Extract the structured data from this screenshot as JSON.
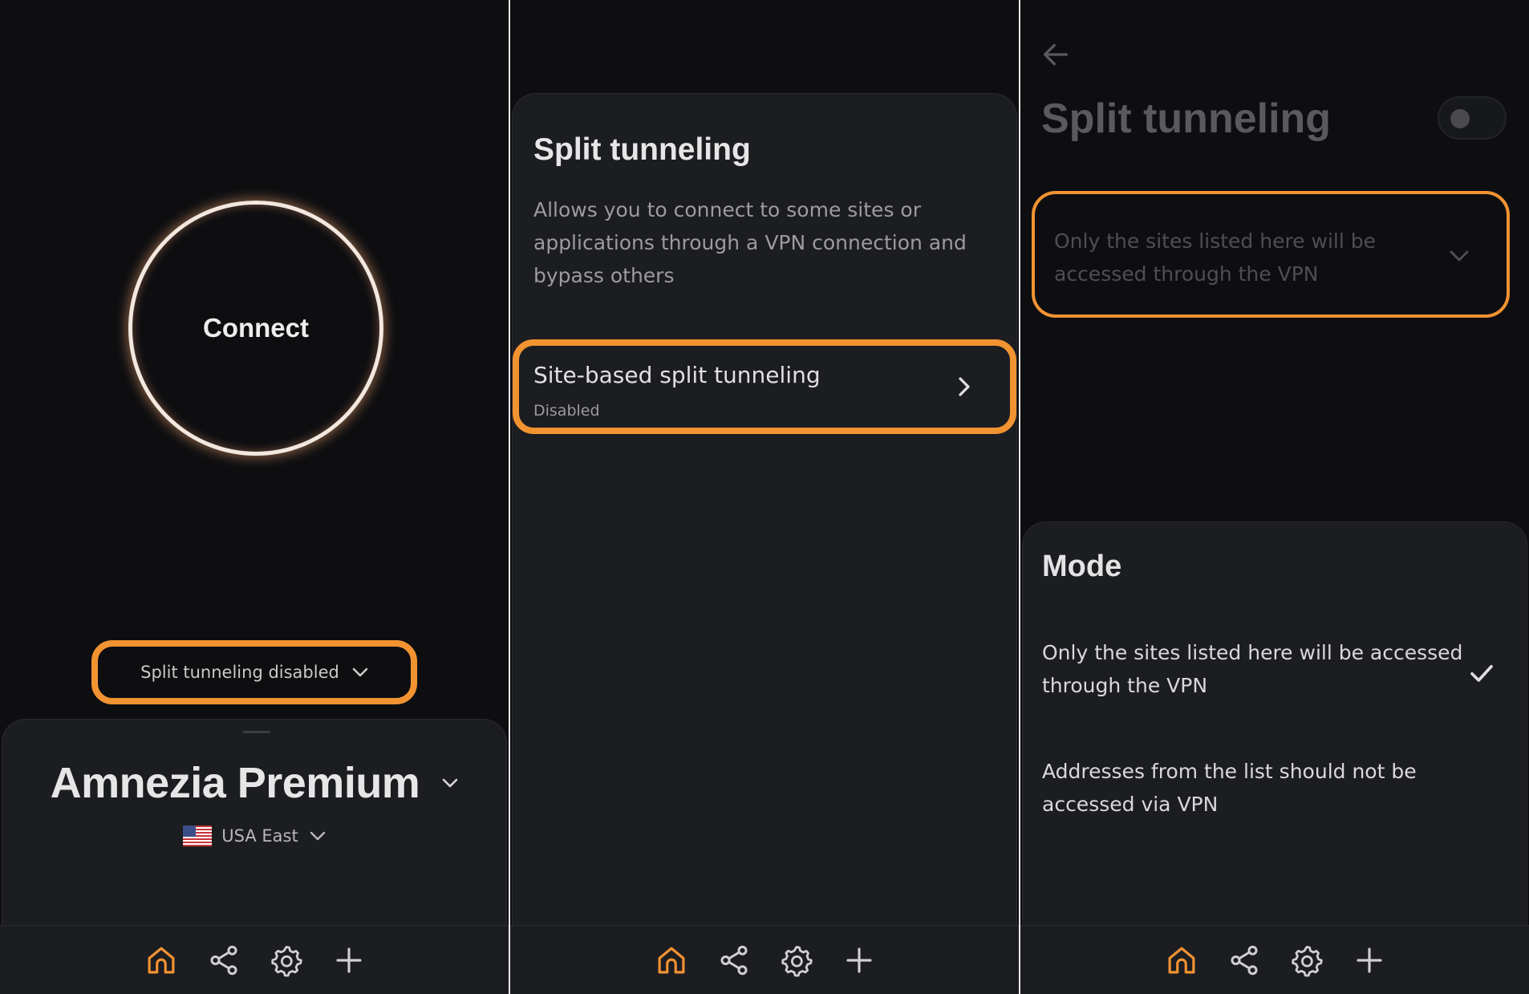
{
  "colors": {
    "accent": "#f29332",
    "background": "#0e0e11",
    "surface": "#1c1d21",
    "active_nav": "#f29332"
  },
  "screen1": {
    "connect_label": "Connect",
    "split_status": "Split tunneling disabled",
    "server_name": "Amnezia Premium",
    "location": "USA East",
    "location_icon": "us-flag-icon"
  },
  "screen2": {
    "title": "Split tunneling",
    "description": "Allows you to connect to some sites or applications through a VPN connection and bypass others",
    "item_title": "Site-based split tunneling",
    "item_status": "Disabled"
  },
  "screen3": {
    "title": "Split tunneling",
    "toggle_on": false,
    "selected_mode": "Only the sites listed here will be accessed through the VPN",
    "sheet_title": "Mode",
    "options": [
      {
        "label": "Only the sites listed here will be accessed through the VPN",
        "selected": true
      },
      {
        "label": "Addresses from the list should not be accessed via VPN",
        "selected": false
      }
    ]
  },
  "nav": {
    "items": [
      "home-icon",
      "share-icon",
      "settings-icon",
      "add-icon"
    ],
    "active": "home-icon"
  }
}
